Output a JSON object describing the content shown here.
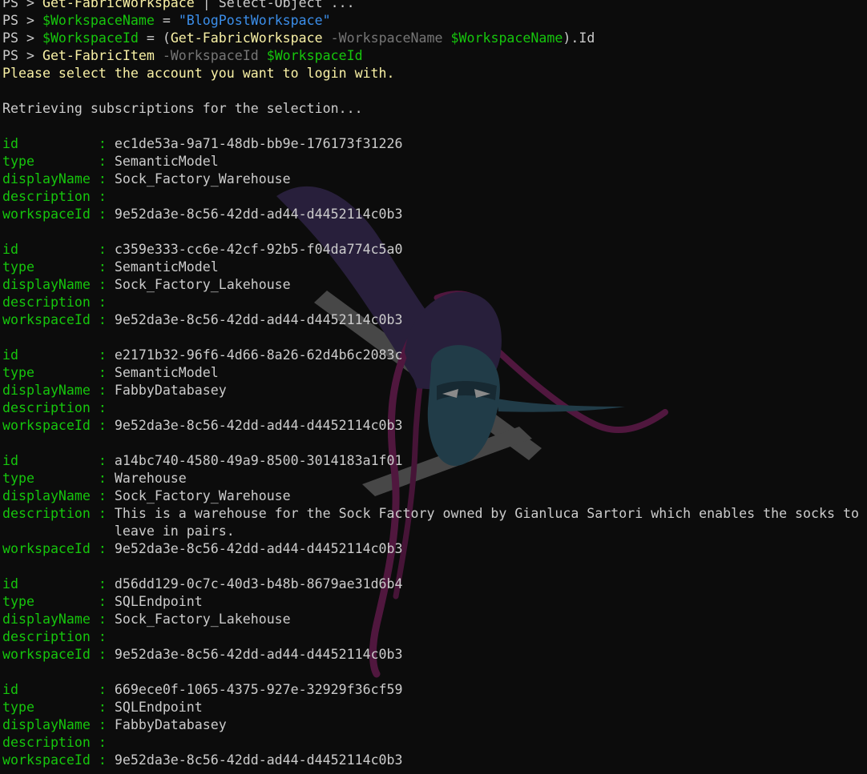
{
  "terminal": {
    "prompt": "PS > ",
    "palette": {
      "background": "#0c0c0c",
      "foreground": "#cccccc",
      "key": "#16c60c",
      "command": "#f9f1a5",
      "variable": "#16c60c",
      "string": "#3b8eea",
      "parameter": "#767676"
    },
    "header_lines": [
      [
        {
          "t": "PS > ",
          "c": "white"
        },
        {
          "t": "Get-FabricWorkspace",
          "c": "yellow"
        },
        {
          "t": " | Select-Object ...",
          "c": "white"
        }
      ],
      [
        {
          "t": "PS > ",
          "c": "white"
        },
        {
          "t": "$WorkspaceName",
          "c": "green"
        },
        {
          "t": " = ",
          "c": "white"
        },
        {
          "t": "\"BlogPostWorkspace\"",
          "c": "blue"
        }
      ],
      [
        {
          "t": "PS > ",
          "c": "white"
        },
        {
          "t": "$WorkspaceId",
          "c": "green"
        },
        {
          "t": " = (",
          "c": "white"
        },
        {
          "t": "Get-FabricWorkspace",
          "c": "yellow"
        },
        {
          "t": " -WorkspaceName ",
          "c": "gray"
        },
        {
          "t": "$WorkspaceName",
          "c": "green"
        },
        {
          "t": ").Id",
          "c": "white"
        }
      ],
      [
        {
          "t": "PS > ",
          "c": "white"
        },
        {
          "t": "Get-FabricItem",
          "c": "yellow"
        },
        {
          "t": " -WorkspaceId ",
          "c": "gray"
        },
        {
          "t": "$WorkspaceId",
          "c": "green"
        }
      ],
      [
        {
          "t": "Please select the account you want to login with.",
          "c": "yellow"
        }
      ],
      [],
      [
        {
          "t": "Retrieving subscriptions for the selection...",
          "c": "white"
        }
      ],
      []
    ],
    "field_keys": {
      "id": "id          : ",
      "type": "type        : ",
      "displayName": "displayName : ",
      "description": "description : ",
      "workspaceId": "workspaceId : ",
      "continuation_indent": "              "
    },
    "items": [
      {
        "id": "ec1de53a-9a71-48db-bb9e-176173f31226",
        "type": "SemanticModel",
        "displayName": "Sock_Factory_Warehouse",
        "description": [
          ""
        ],
        "workspaceId": "9e52da3e-8c56-42dd-ad44-d4452114c0b3"
      },
      {
        "id": "c359e333-cc6e-42cf-92b5-f04da774c5a0",
        "type": "SemanticModel",
        "displayName": "Sock_Factory_Lakehouse",
        "description": [
          ""
        ],
        "workspaceId": "9e52da3e-8c56-42dd-ad44-d4452114c0b3"
      },
      {
        "id": "e2171b32-96f6-4d66-8a26-62d4b6c2083c",
        "type": "SemanticModel",
        "displayName": "FabbyDatabasey",
        "description": [
          ""
        ],
        "workspaceId": "9e52da3e-8c56-42dd-ad44-d4452114c0b3"
      },
      {
        "id": "a14bc740-4580-49a9-8500-3014183a1f01",
        "type": "Warehouse",
        "displayName": "Sock_Factory_Warehouse",
        "description": [
          "This is a warehouse for the Sock Factory owned by Gianluca Sartori which enables the socks to",
          "leave in pairs."
        ],
        "workspaceId": "9e52da3e-8c56-42dd-ad44-d4452114c0b3"
      },
      {
        "id": "d56dd129-0c7c-40d3-b48b-8679ae31d6b4",
        "type": "SQLEndpoint",
        "displayName": "Sock_Factory_Lakehouse",
        "description": [
          ""
        ],
        "workspaceId": "9e52da3e-8c56-42dd-ad44-d4452114c0b3"
      },
      {
        "id": "669ece0f-1065-4375-927e-32929f36cf59",
        "type": "SQLEndpoint",
        "displayName": "FabbyDatabasey",
        "description": [
          ""
        ],
        "workspaceId": "9e52da3e-8c56-42dd-ad44-d4452114c0b3"
      }
    ],
    "watermark_icon": "ninja-mascot-logo"
  }
}
